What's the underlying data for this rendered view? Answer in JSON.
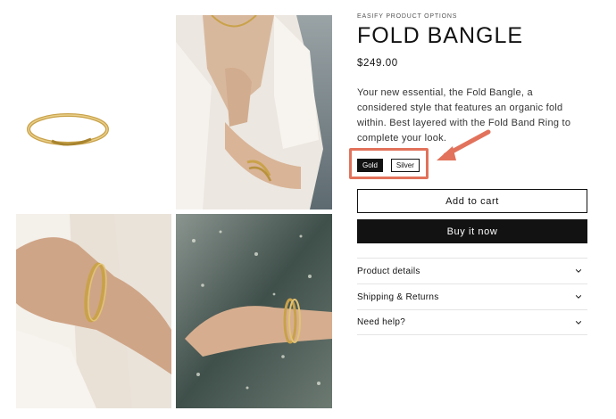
{
  "product": {
    "vendor": "EASIFY PRODUCT OPTIONS",
    "title": "FOLD BANGLE",
    "price": "$249.00",
    "description": "Your new essential, the Fold Bangle, a considered style that features an organic fold within. Best layered with the Fold Band Ring to complete your look."
  },
  "options": {
    "swatches": [
      {
        "label": "Gold",
        "selected": true
      },
      {
        "label": "Silver",
        "selected": false
      }
    ]
  },
  "buttons": {
    "add_to_cart": "Add to cart",
    "buy_now": "Buy it now"
  },
  "accordion": [
    {
      "label": "Product details",
      "icon": "chevron-down-icon"
    },
    {
      "label": "Shipping & Returns",
      "icon": "chevron-down-icon"
    },
    {
      "label": "Need help?",
      "icon": "chevron-down-icon"
    }
  ],
  "colors": {
    "accent": "#121212",
    "annotation": "#e2725b",
    "gold": "#c9a24a"
  }
}
